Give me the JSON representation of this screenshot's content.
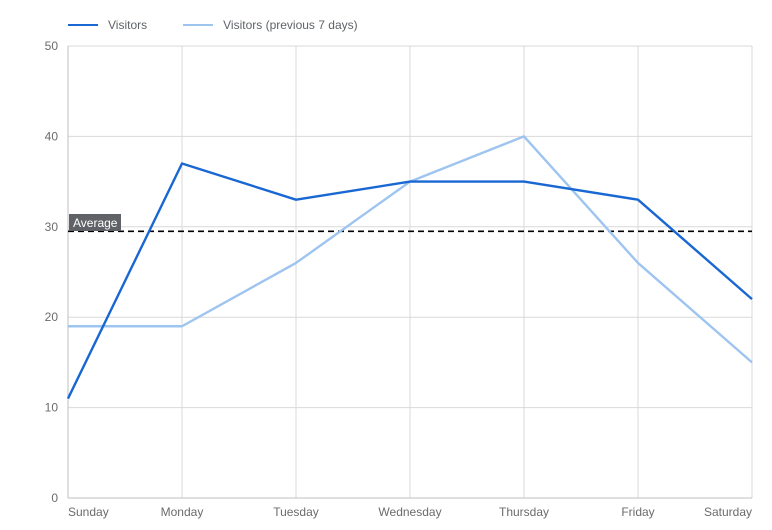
{
  "chart_data": {
    "type": "line",
    "categories": [
      "Sunday",
      "Monday",
      "Tuesday",
      "Wednesday",
      "Thursday",
      "Friday",
      "Saturday"
    ],
    "series": [
      {
        "name": "Visitors",
        "color": "#1967d2",
        "values": [
          11,
          37,
          33,
          35,
          35,
          33,
          22
        ]
      },
      {
        "name": "Visitors (previous 7 days)",
        "color": "#9ec4f0",
        "values": [
          19,
          19,
          26,
          35,
          40,
          26,
          15
        ]
      }
    ],
    "reference_line": {
      "label": "Average",
      "value": 29.5,
      "style": "dashed",
      "color": "#000"
    },
    "ylabel": "",
    "xlabel": "",
    "ylim": [
      0,
      50
    ],
    "yticks": [
      0,
      10,
      20,
      30,
      40,
      50
    ],
    "grid": true
  }
}
